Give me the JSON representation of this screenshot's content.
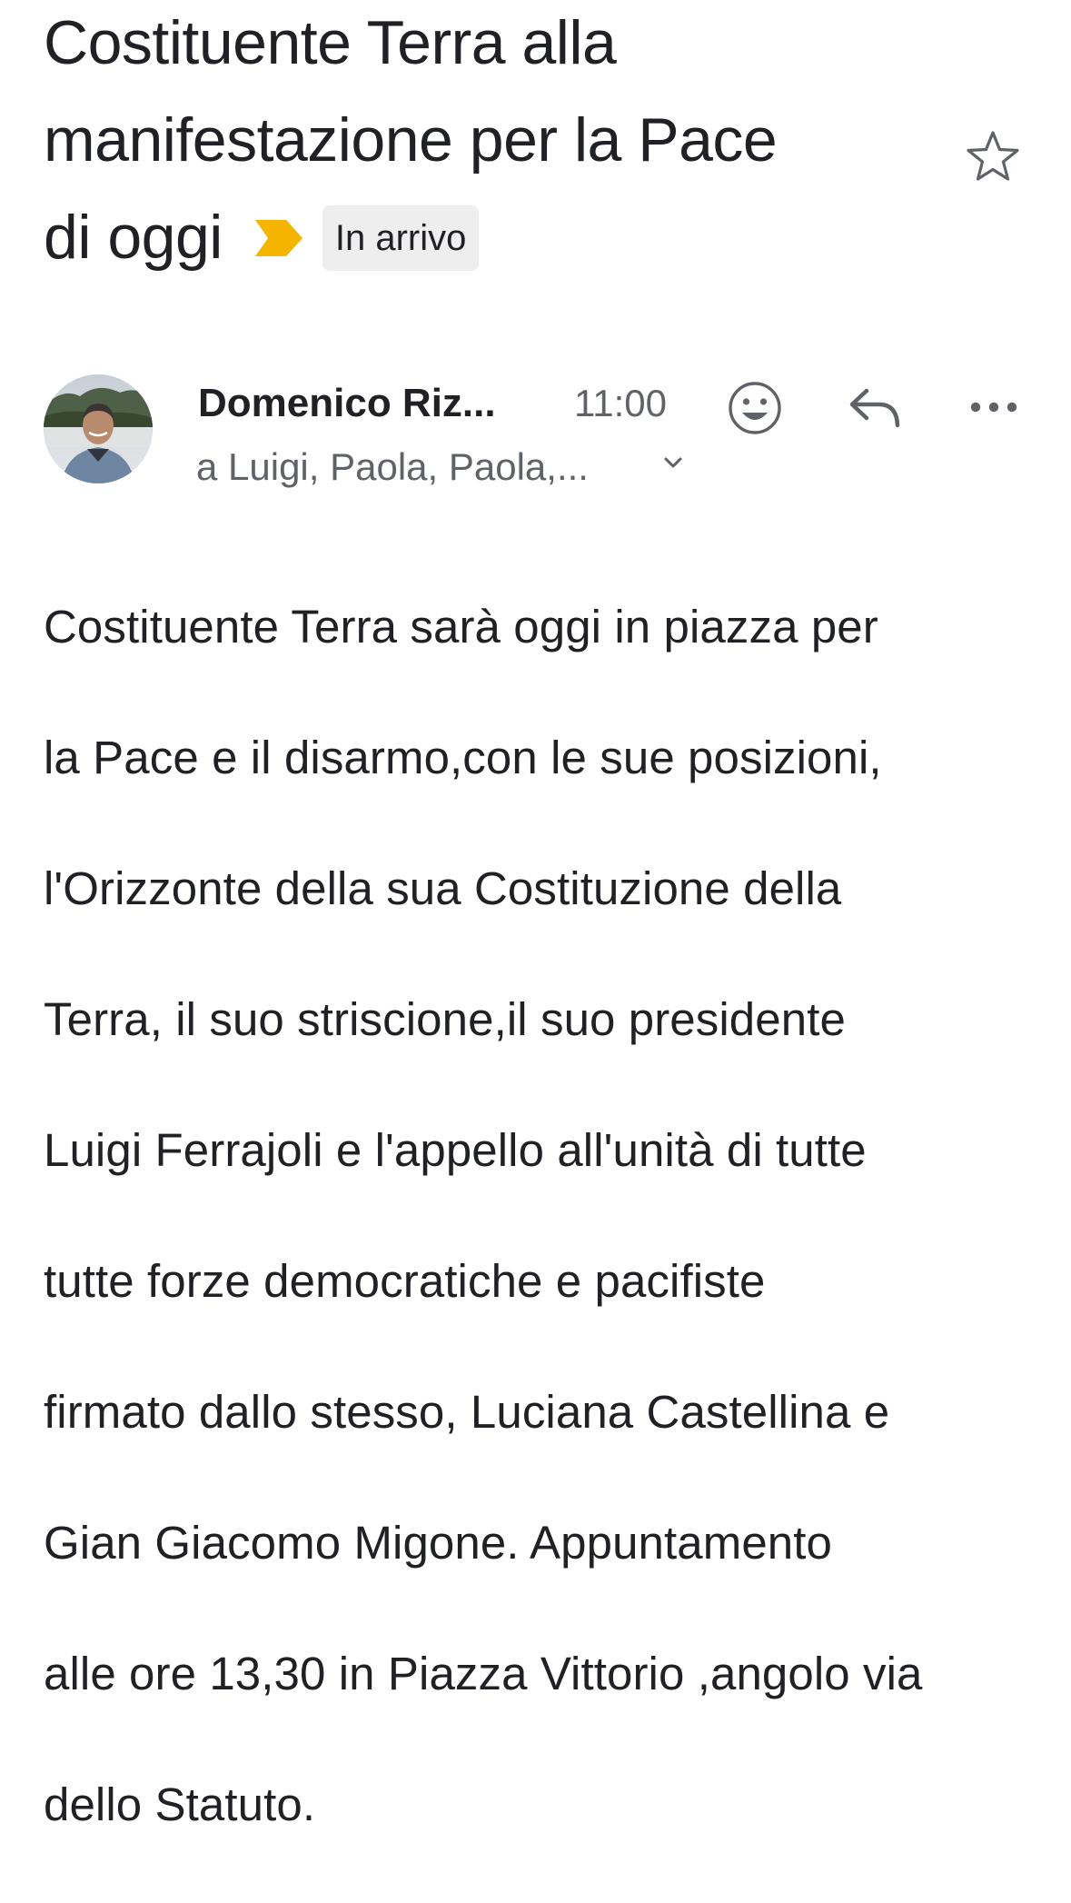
{
  "email": {
    "subject_line1": "Costituente Terra alla",
    "subject_line2": "manifestazione per la Pace",
    "subject_line3": "di oggi",
    "label": "In arrivo",
    "important_color": "#f4b400"
  },
  "message": {
    "sender": "Domenico Riz...",
    "time": "11:00",
    "recipients": "a Luigi, Paola, Paola,...",
    "body_lines": [
      "Costituente Terra sarà oggi in piazza per",
      "la Pace e il disarmo,con le sue posizioni,",
      "l'Orizzonte della sua Costituzione della",
      "Terra, il suo striscione,il suo presidente",
      "Luigi Ferrajoli e l'appello all'unità  di tutte",
      "tutte forze democratiche e pacifiste",
      "firmato dallo stesso, Luciana Castellina e",
      "Gian Giacomo Migone.  Appuntamento",
      "alle ore 13,30 in Piazza Vittorio ,angolo via",
      "dello Statuto."
    ]
  },
  "icons": {
    "star": "star-outline-icon",
    "important": "importance-marker-icon",
    "emoji": "add-emoji-icon",
    "reply": "reply-icon",
    "more": "more-horizontal-icon",
    "expand": "chevron-down-icon"
  }
}
